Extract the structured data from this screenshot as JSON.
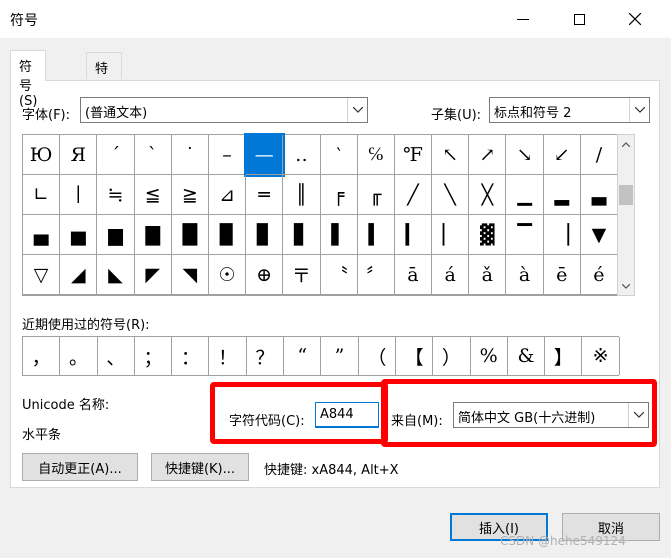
{
  "window": {
    "title": "符号",
    "minimize_icon": "minimize-icon",
    "maximize_icon": "maximize-icon",
    "close_icon": "close-icon"
  },
  "tabs": [
    {
      "label": "符号(S)",
      "active": true
    },
    {
      "label": "特殊字符(P)",
      "active": false
    }
  ],
  "font": {
    "label": "字体(F):",
    "value": "(普通文本)"
  },
  "subset": {
    "label": "子集(U):",
    "value": "标点和符号 2"
  },
  "symbol_grid": {
    "rows": [
      [
        "Ю",
        "Я",
        "ˊ",
        "ˋ",
        "˙",
        "–",
        "—",
        "‥",
        "‵",
        "℅",
        "℉",
        "↖",
        "↗",
        "↘",
        "↙",
        "∕"
      ],
      [
        "∟",
        "∣",
        "≒",
        "≦",
        "≧",
        "⊿",
        "═",
        "║",
        "╒",
        "╓",
        "╱",
        "╲",
        "╳",
        "▁",
        "▂",
        "▃"
      ],
      [
        "▄",
        "▅",
        "▆",
        "▇",
        "█",
        "▉",
        "▊",
        "▋",
        "▌",
        "▍",
        "▎",
        "▏",
        "▓",
        "▔",
        "▕",
        "▼"
      ],
      [
        "▽",
        "◢",
        "◣",
        "◤",
        "◥",
        "☉",
        "⊕",
        "〒",
        "〝",
        "〞",
        "ā",
        "á",
        "ǎ",
        "à",
        "ē",
        "é"
      ]
    ],
    "selected_row": 0,
    "selected_col": 6
  },
  "recent": {
    "label": "近期使用过的符号(R):",
    "symbols": [
      "，",
      "。",
      "、",
      "；",
      "：",
      "！",
      "？",
      "“",
      "”",
      "（",
      "【",
      "）",
      "%",
      "&",
      "】",
      "※"
    ]
  },
  "unicode_name": {
    "label": "Unicode 名称:",
    "value": "水平条"
  },
  "char_code": {
    "label": "字符代码(C):",
    "value": "A844"
  },
  "from": {
    "label": "来自(M):",
    "value": "简体中文 GB(十六进制)"
  },
  "buttons": {
    "autocorrect": "自动更正(A)...",
    "shortcut_key": "快捷键(K)...",
    "shortcut_text": "快捷键: xA844, Alt+X",
    "insert": "插入(I)",
    "cancel": "取消"
  },
  "watermark": "CSDN @hehe549124",
  "colors": {
    "highlight": "#ff0000",
    "selection": "#0078d7"
  }
}
